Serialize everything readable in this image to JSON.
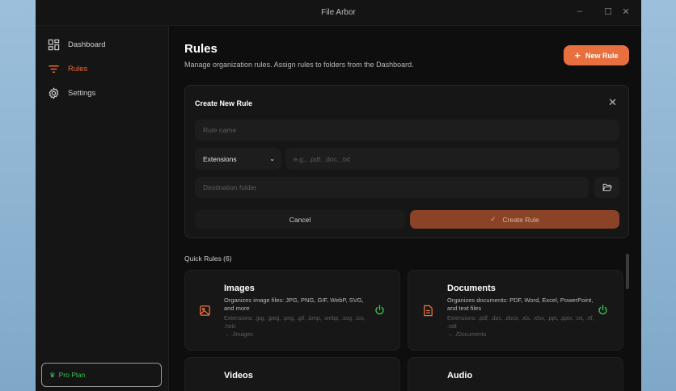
{
  "window": {
    "title": "File Arbor"
  },
  "sidebar": {
    "items": [
      {
        "label": "Dashboard"
      },
      {
        "label": "Rules"
      },
      {
        "label": "Settings"
      }
    ],
    "plan": "Pro Plan"
  },
  "header": {
    "title": "Rules",
    "subtitle": "Manage organization rules. Assign rules to folders from the Dashboard.",
    "new_rule": "New Rule"
  },
  "form": {
    "title": "Create New Rule",
    "rule_name_placeholder": "Rule name",
    "type_value": "Extensions",
    "extensions_placeholder": "e.g., .pdf, .doc, .txt",
    "destination_placeholder": "Destination folder",
    "cancel": "Cancel",
    "create": "Create Rule"
  },
  "quick_rules": {
    "title": "Quick Rules (6)",
    "cards": [
      {
        "name": "Images",
        "desc": "Organizes image files: JPG, PNG, GIF, WebP, SVG, and more",
        "ext": "Extensions: .jpg, .jpeg, .png, .gif, .bmp, .webp, .svg, .ico, .heic",
        "dest": "→ ./Images"
      },
      {
        "name": "Documents",
        "desc": "Organizes documents: PDF, Word, Excel, PowerPoint, and text files",
        "ext": "Extensions: .pdf, .doc, .docx, .xls, .xlsx, .ppt, .pptx, .txt, .rtf, .odt",
        "dest": "→ ./Documents"
      },
      {
        "name": "Videos"
      },
      {
        "name": "Audio"
      }
    ]
  },
  "colors": {
    "accent": "#e8703e",
    "success": "#3fbf55"
  }
}
